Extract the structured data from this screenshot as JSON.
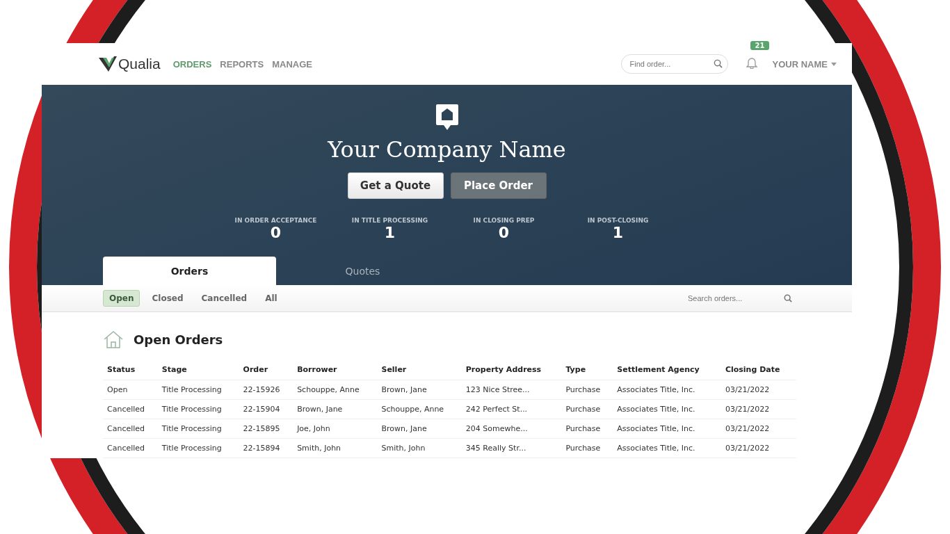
{
  "nav": {
    "brand": "Qualia",
    "links": [
      {
        "label": "ORDERS",
        "selected": true
      },
      {
        "label": "REPORTS",
        "selected": false
      },
      {
        "label": "MANAGE",
        "selected": false
      }
    ],
    "search": {
      "placeholder": "Find order..."
    },
    "notifications": "21",
    "user": "YOUR NAME"
  },
  "hero": {
    "title": "Your Company Name",
    "buttons": [
      {
        "label": "Get a Quote",
        "kind": "light"
      },
      {
        "label": "Place Order",
        "kind": "dark"
      }
    ],
    "stats": [
      {
        "label": "IN ORDER ACCEPTANCE",
        "value": "0"
      },
      {
        "label": "IN TITLE PROCESSING",
        "value": "1"
      },
      {
        "label": "IN CLOSING PREP",
        "value": "0"
      },
      {
        "label": "IN POST-CLOSING",
        "value": "1"
      }
    ]
  },
  "tabs": [
    {
      "label": "Orders",
      "selected": true
    },
    {
      "label": "Quotes",
      "selected": false
    }
  ],
  "filters": [
    {
      "label": "Open",
      "selected": true
    },
    {
      "label": "Closed",
      "selected": false
    },
    {
      "label": "Cancelled",
      "selected": false
    },
    {
      "label": "All",
      "selected": false
    }
  ],
  "order_search": {
    "placeholder": "Search orders..."
  },
  "table": {
    "title": "Open Orders",
    "columns": [
      "Status",
      "Stage",
      "Order",
      "Borrower",
      "Seller",
      "Property Address",
      "Type",
      "Settlement Agency",
      "Closing Date"
    ],
    "rows": [
      [
        "Open",
        "Title Processing",
        "22-15926",
        "Schouppe, Anne",
        "Brown, Jane",
        "123 Nice Stree...",
        "Purchase",
        "Associates Title, Inc.",
        "03/21/2022"
      ],
      [
        "Cancelled",
        "Title Processing",
        "22-15904",
        "Brown, Jane",
        "Schouppe, Anne",
        "242 Perfect St...",
        "Purchase",
        "Associates Title, Inc.",
        "03/21/2022"
      ],
      [
        "Cancelled",
        "Title Processing",
        "22-15895",
        "Joe, John",
        "Brown, Jane",
        "204 Somewhe...",
        "Purchase",
        "Associates Title, Inc.",
        "03/21/2022"
      ],
      [
        "Cancelled",
        "Title Processing",
        "22-15894",
        "Smith, John",
        "Smith, John",
        "345 Really Str...",
        "Purchase",
        "Associates Title, Inc.",
        "03/21/2022"
      ]
    ]
  }
}
